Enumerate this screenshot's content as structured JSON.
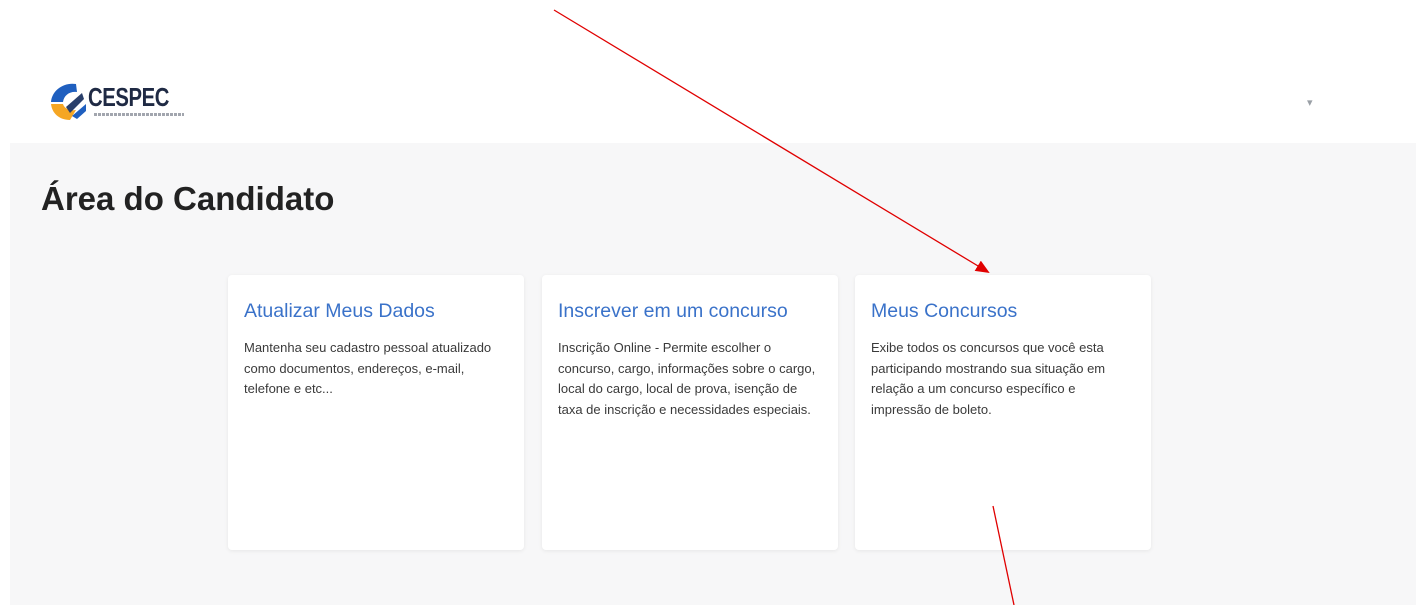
{
  "header": {
    "logo_text": "CESPEC",
    "logo_tagline": "CENTRO DE SELEÇÃO, PESQUISA E CONCURSOS",
    "user_menu_caret": "▾"
  },
  "page": {
    "title": "Área do Candidato"
  },
  "cards": [
    {
      "title": "Atualizar Meus Dados",
      "text": "Mantenha seu cadastro pessoal atualizado como documentos, endereços, e-mail, telefone e etc..."
    },
    {
      "title": "Inscrever em um concurso",
      "text": "Inscrição Online - Permite escolher o concurso, cargo, informações sobre o cargo, local do cargo, local de prova, isenção de taxa de inscrição e necessidades especiais."
    },
    {
      "title": "Meus Concursos",
      "text": "Exibe todos os concursos que você esta participando mostrando sua situação em relação a um concurso específico e impressão de boleto."
    }
  ],
  "colors": {
    "link": "#3a72c9",
    "annotation_arrow": "#e00000",
    "logo_orange": "#f5a623",
    "logo_blue": "#1f5fbf"
  },
  "icons": [
    "cespec-logo-icon",
    "caret-down-icon",
    "annotation-arrow"
  ]
}
